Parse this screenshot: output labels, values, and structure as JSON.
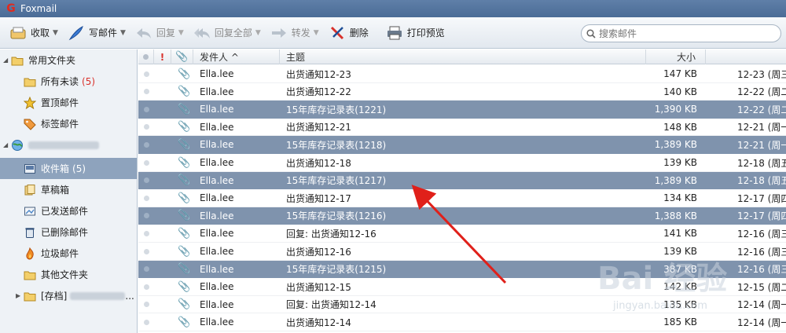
{
  "window": {
    "title": "Foxmail"
  },
  "toolbar": {
    "receive": "收取",
    "compose": "写邮件",
    "reply": "回复",
    "reply_all": "回复全部",
    "forward": "转发",
    "delete": "删除",
    "print_preview": "打印预览"
  },
  "search": {
    "placeholder": "搜索邮件"
  },
  "sidebar": {
    "favorites_label": "常用文件夹",
    "all_unread": "所有未读",
    "all_unread_count": "(5)",
    "pinned": "置顶邮件",
    "tagged": "标签邮件",
    "inbox": "收件箱",
    "inbox_count": "(5)",
    "drafts": "草稿箱",
    "sent": "已发送邮件",
    "deleted": "已删除邮件",
    "junk": "垃圾邮件",
    "other": "其他文件夹",
    "archive": "[存档]",
    "archive_suffix": "..."
  },
  "columns": {
    "flag": "!",
    "sender": "发件人 ^",
    "subject": "主题",
    "size": "大小"
  },
  "emails": [
    {
      "sender": "Ella.lee",
      "subject": "出货通知12-23",
      "size": "147 KB",
      "date": "12-23 (周三",
      "highlighted": false
    },
    {
      "sender": "Ella.lee",
      "subject": "出货通知12-22",
      "size": "140 KB",
      "date": "12-22 (周二",
      "highlighted": false
    },
    {
      "sender": "Ella.lee",
      "subject": "15年库存记录表(1221)",
      "size": "1,390 KB",
      "date": "12-22 (周二",
      "highlighted": true
    },
    {
      "sender": "Ella.lee",
      "subject": "出货通知12-21",
      "size": "148 KB",
      "date": "12-21 (周一",
      "highlighted": false
    },
    {
      "sender": "Ella.lee",
      "subject": "15年库存记录表(1218)",
      "size": "1,389 KB",
      "date": "12-21 (周一",
      "highlighted": true
    },
    {
      "sender": "Ella.lee",
      "subject": "出货通知12-18",
      "size": "139 KB",
      "date": "12-18 (周五",
      "highlighted": false
    },
    {
      "sender": "Ella.lee",
      "subject": "15年库存记录表(1217)",
      "size": "1,389 KB",
      "date": "12-18 (周五",
      "highlighted": true
    },
    {
      "sender": "Ella.lee",
      "subject": "出货通知12-17",
      "size": "134 KB",
      "date": "12-17 (周四",
      "highlighted": false
    },
    {
      "sender": "Ella.lee",
      "subject": "15年库存记录表(1216)",
      "size": "1,388 KB",
      "date": "12-17 (周四",
      "highlighted": true
    },
    {
      "sender": "Ella.lee",
      "subject": "回复: 出货通知12-16",
      "size": "141 KB",
      "date": "12-16 (周三",
      "highlighted": false
    },
    {
      "sender": "Ella.lee",
      "subject": "出货通知12-16",
      "size": "139 KB",
      "date": "12-16 (周三",
      "highlighted": false
    },
    {
      "sender": "Ella.lee",
      "subject": "15年库存记录表(1215)",
      "size": "387 KB",
      "date": "12-16 (周三",
      "highlighted": true
    },
    {
      "sender": "Ella.lee",
      "subject": "出货通知12-15",
      "size": "142 KB",
      "date": "12-15 (周二",
      "highlighted": false
    },
    {
      "sender": "Ella.lee",
      "subject": "回复: 出货通知12-14",
      "size": "135 KB",
      "date": "12-14 (周一",
      "highlighted": false
    },
    {
      "sender": "Ella.lee",
      "subject": "出货通知12-14",
      "size": "185 KB",
      "date": "12-14 (周一",
      "highlighted": false
    }
  ],
  "watermark": {
    "main": "Bai 经验",
    "sub": "jingyan.baidu.com"
  },
  "colors": {
    "highlight": "#7f93ad",
    "accent_red": "#d9312b",
    "arrow_red": "#e0201a"
  }
}
